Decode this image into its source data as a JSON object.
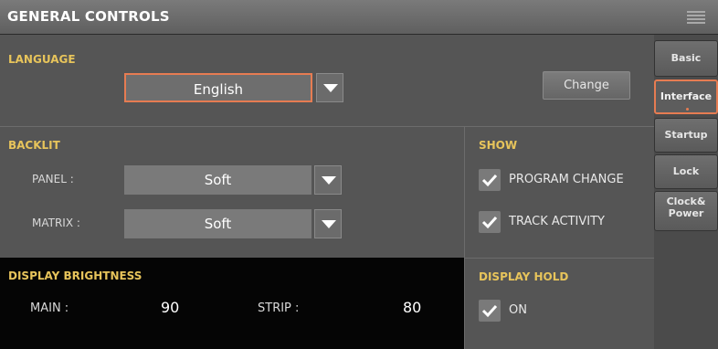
{
  "header": {
    "title": "GENERAL CONTROLS",
    "menu_icon": "menu-icon"
  },
  "language": {
    "label": "LANGUAGE",
    "value": "English",
    "change_button": "Change"
  },
  "backlit": {
    "label": "BACKLIT",
    "panel_label": "PANEL :",
    "panel_value": "Soft",
    "matrix_label": "MATRIX :",
    "matrix_value": "Soft"
  },
  "show": {
    "label": "SHOW",
    "program_change": {
      "label": "PROGRAM CHANGE",
      "checked": true
    },
    "track_activity": {
      "label": "TRACK ACTIVITY",
      "checked": true
    }
  },
  "display_brightness": {
    "label": "DISPLAY BRIGHTNESS",
    "main_label": "MAIN :",
    "main_value": "90",
    "strip_label": "STRIP :",
    "strip_value": "80"
  },
  "display_hold": {
    "label": "DISPLAY HOLD",
    "on": {
      "label": "ON",
      "checked": true
    }
  },
  "tabs": [
    "Basic",
    "Interface",
    "Startup",
    "Lock",
    "Clock& Power"
  ],
  "active_tab": "Interface",
  "colors": {
    "accent": "#e67c52",
    "section_label": "#e7c45b"
  }
}
